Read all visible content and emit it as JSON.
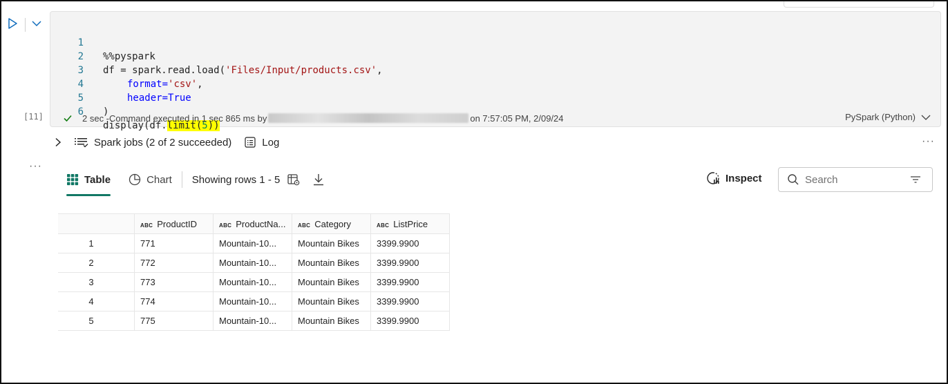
{
  "cell": {
    "execution_count": "[11]",
    "code_lines": [
      {
        "n": "1"
      },
      {
        "n": "2"
      },
      {
        "n": "3"
      },
      {
        "n": "4"
      },
      {
        "n": "5"
      },
      {
        "n": "6"
      }
    ],
    "code": {
      "l1": "%%pyspark",
      "l2_a": "df = spark.read.load(",
      "l2_b": "'Files/Input/products.csv'",
      "l2_c": ",",
      "l3_a": "format=",
      "l3_b": "'csv'",
      "l3_c": ",",
      "l4_a": "header=",
      "l4_b": "True",
      "l5": ")",
      "l6_a": "display(df.",
      "l6_b": "limit(",
      "l6_c": "5",
      "l6_d": "))"
    },
    "status_prefix": "2 sec -Command executed in 1 sec 865 ms by",
    "status_suffix": "on 7:57:05 PM, 2/09/24",
    "language": "PySpark (Python)"
  },
  "output": {
    "spark_jobs": "Spark jobs (2 of 2 succeeded)",
    "log": "Log",
    "more": "···",
    "tabs": {
      "table": "Table",
      "chart": "Chart"
    },
    "showing_rows": "Showing rows 1 - 5",
    "inspect": "Inspect",
    "search_placeholder": "Search"
  },
  "table": {
    "type_badge": "ABC",
    "columns": [
      "ProductID",
      "ProductNa...",
      "Category",
      "ListPrice"
    ],
    "rows": [
      {
        "idx": "1",
        "cells": [
          "771",
          "Mountain-10...",
          "Mountain Bikes",
          "3399.9900"
        ]
      },
      {
        "idx": "2",
        "cells": [
          "772",
          "Mountain-10...",
          "Mountain Bikes",
          "3399.9900"
        ]
      },
      {
        "idx": "3",
        "cells": [
          "773",
          "Mountain-10...",
          "Mountain Bikes",
          "3399.9900"
        ]
      },
      {
        "idx": "4",
        "cells": [
          "774",
          "Mountain-10...",
          "Mountain Bikes",
          "3399.9900"
        ]
      },
      {
        "idx": "5",
        "cells": [
          "775",
          "Mountain-10...",
          "Mountain Bikes",
          "3399.9900"
        ]
      }
    ]
  },
  "colors": {
    "accent": "#117865",
    "run": "#0f6cbd",
    "success": "#107c10",
    "highlight": "#ffff00"
  }
}
